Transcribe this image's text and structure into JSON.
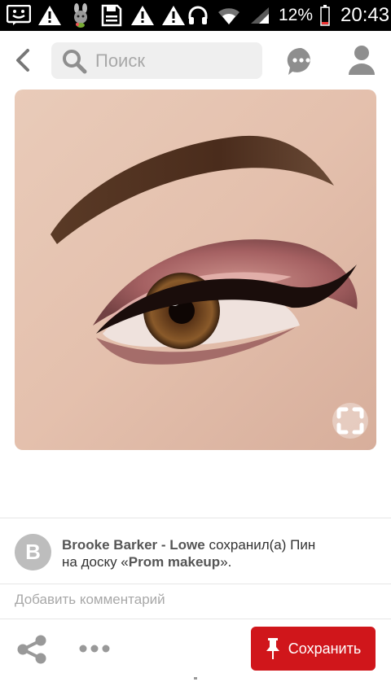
{
  "status_bar": {
    "battery": "12%",
    "time": "20:43"
  },
  "header": {
    "search_placeholder": "Поиск"
  },
  "pin": {
    "saved_by": "Brooke Barker - Lowe",
    "saved_action": " сохранил(а) Пин",
    "board_prefix": "на доску «",
    "board_name": "Prom makeup",
    "board_suffix": "».",
    "avatar_letter": "B"
  },
  "comment_placeholder": "Добавить комментарий",
  "actions": {
    "save_label": "Сохранить"
  },
  "colors": {
    "accent": "#d0161b",
    "statusbar": "#000000",
    "search_bg": "#efefef"
  }
}
